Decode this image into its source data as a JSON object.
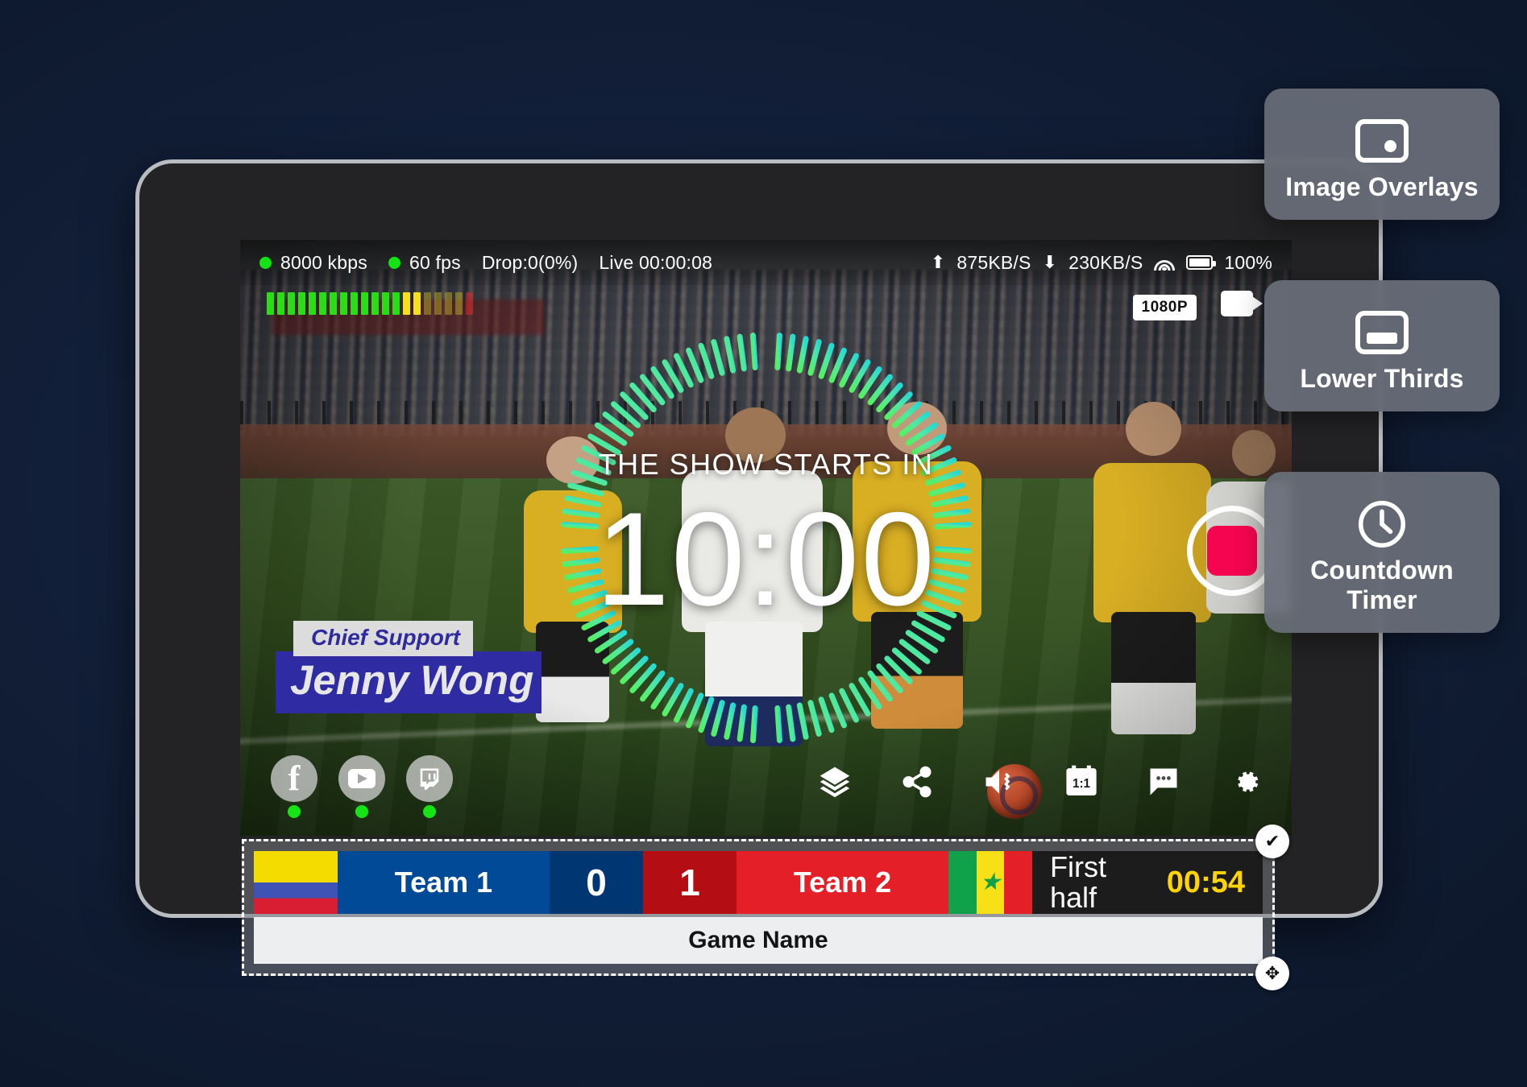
{
  "theme": {
    "page_bg": "#13203a",
    "accent_green": "#14e313",
    "record_red": "#f5054f",
    "timer_yellow": "#ffd400"
  },
  "status_bar": {
    "bitrate": "8000 kbps",
    "fps": "60 fps",
    "drop": "Drop:0(0%)",
    "live": "Live 00:00:08",
    "upload": "875KB/S",
    "download": "230KB/S",
    "battery": "100%",
    "upload_icon": "arrow-up-icon",
    "download_icon": "arrow-down-icon",
    "wifi_icon": "wifi-icon",
    "battery_icon": "battery-icon"
  },
  "preview": {
    "resolution_badge": "1080P",
    "camera_icon": "video-camera-icon",
    "record_icon": "record-stop-icon",
    "audio_meter": {
      "segments": 20,
      "green": 13,
      "yellow": 2,
      "dim": 4,
      "red": 1
    }
  },
  "countdown": {
    "label": "THE SHOW STARTS IN",
    "time": "10:00",
    "ring_ticks": 96,
    "ring_color_start": "#55f062",
    "ring_color_end": "#27d9d2"
  },
  "lower_third": {
    "role": "Chief Support",
    "name": "Jenny Wong",
    "role_bg": "#dcdcdc",
    "role_color": "#2f2a9e",
    "name_bg": "#2e2ba3",
    "name_color": "#e7e7e7"
  },
  "social": [
    {
      "name": "facebook",
      "glyph": "f",
      "live": true
    },
    {
      "name": "youtube",
      "glyph": "youtube-play-icon",
      "live": true
    },
    {
      "name": "twitch",
      "glyph": "twitch-icon",
      "live": true
    }
  ],
  "toolbar": [
    {
      "name": "layers-icon",
      "label": "Layers"
    },
    {
      "name": "share-icon",
      "label": "Share"
    },
    {
      "name": "audio-icon",
      "label": "Audio"
    },
    {
      "name": "aspect-ratio-icon",
      "label": "1:1"
    },
    {
      "name": "chat-icon",
      "label": "Chat"
    },
    {
      "name": "settings-gear-icon",
      "label": "Settings"
    }
  ],
  "scoreboard": {
    "team1": {
      "name": "Team 1",
      "score": "0",
      "flag": "colombia",
      "bg": "#004a97",
      "score_bg": "#003772"
    },
    "team2": {
      "name": "Team 2",
      "score": "1",
      "flag": "senegal",
      "bg": "#e41f27",
      "score_bg": "#b50d14"
    },
    "period": "First half",
    "period_time": "00:54",
    "game_name": "Game Name",
    "handles": {
      "confirm": "✔",
      "move": "✥"
    }
  },
  "feature_cards": [
    {
      "id": "image-overlays",
      "label": "Image Overlays",
      "icon": "image-overlay-icon"
    },
    {
      "id": "lower-thirds",
      "label": "Lower Thirds",
      "icon": "lower-third-icon"
    },
    {
      "id": "countdown-timer",
      "label": "Countdown Timer",
      "icon": "clock-icon"
    }
  ]
}
